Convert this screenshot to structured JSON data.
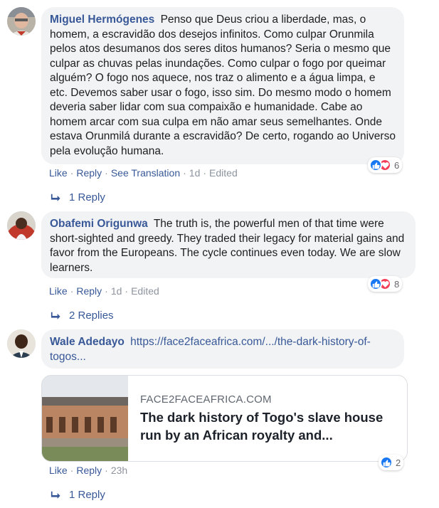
{
  "comments": [
    {
      "author": "Miguel Hermógenes",
      "text": "Penso que Deus criou a liberdade, mas, o homem, a escravidão dos desejos infinitos. Como culpar Orunmila pelos atos desumanos dos seres ditos humanos? Seria o mesmo que culpar as chuvas pelas inundações. Como culpar o fogo por queimar alguém? O fogo nos aquece, nos traz o alimento e a água limpa, e etc. Devemos saber usar o fogo, isso sim. Do mesmo modo o homem deveria saber lidar com sua compaixão e humanidade. Cabe ao homem arcar com sua culpa em não amar seus semelhantes. Onde estava Orunmilá durante a escravidão? De certo, rogando ao Universo pela evolução humana.",
      "reaction_count": "6",
      "like": "Like",
      "reply": "Reply",
      "see_translation": "See Translation",
      "time": "1d",
      "edited": "Edited",
      "replies": "1 Reply"
    },
    {
      "author": "Obafemi Origunwa",
      "text": "The truth is, the powerful men of that time were short-sighted and greedy. They traded their legacy for material gains and favor from the Europeans. The cycle continues even today. We are slow learners.",
      "reaction_count": "8",
      "like": "Like",
      "reply": "Reply",
      "time": "1d",
      "edited": "Edited",
      "replies": "2 Replies"
    },
    {
      "author": "Wale Adedayo",
      "link_text": "https://face2faceafrica.com/.../the-dark-history-of-togos...",
      "card": {
        "domain": "FACE2FACEAFRICA.COM",
        "title": "The dark history of Togo's slave house run by an African royalty and..."
      },
      "reaction_count": "2",
      "like": "Like",
      "reply": "Reply",
      "time": "23h",
      "replies": "1 Reply"
    }
  ],
  "icons": {
    "like": "thumbs-up-icon",
    "love": "heart-icon",
    "reply_arrow": "reply-arrow-icon"
  },
  "colors": {
    "link": "#385898",
    "bubble": "#f2f3f5",
    "like": "#1877f2",
    "love": "#f33e58",
    "meta": "#8d949e"
  }
}
